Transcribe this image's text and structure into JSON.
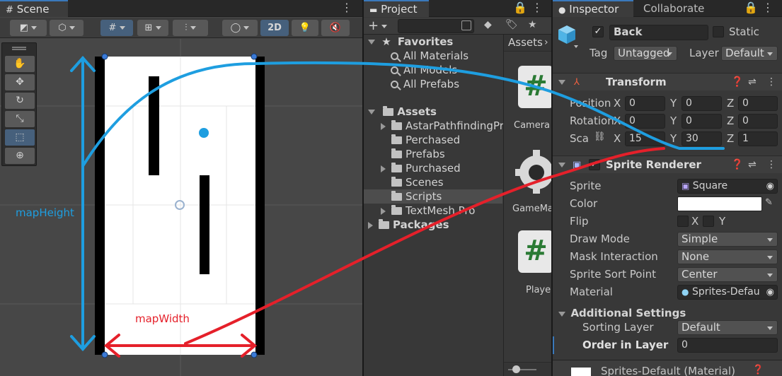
{
  "scene": {
    "tab_label": "Scene",
    "toolbar": {
      "mode_2d": "2D"
    },
    "annotations": {
      "map_height": "mapHeight",
      "map_width": "mapWidth"
    }
  },
  "project": {
    "tab_label": "Project",
    "breadcrumb": "Assets",
    "favorites": {
      "label": "Favorites",
      "items": [
        "All Materials",
        "All Models",
        "All Prefabs"
      ]
    },
    "assets": {
      "label": "Assets",
      "items": [
        "AstarPathfindingPr",
        "Perchased",
        "Prefabs",
        "Purchased",
        "Scenes",
        "Scripts",
        "TextMesh Pro"
      ]
    },
    "packages_label": "Packages",
    "grid_items": [
      "Camera",
      "GameMa",
      "Playe"
    ]
  },
  "inspector": {
    "tabs": [
      "Inspector",
      "Collaborate"
    ],
    "object": {
      "name": "Back",
      "static_label": "Static",
      "tag_label": "Tag",
      "tag_value": "Untagged",
      "layer_label": "Layer",
      "layer_value": "Default"
    },
    "transform": {
      "title": "Transform",
      "position_label": "Position",
      "rotation_label": "Rotation",
      "scale_label": "Sca",
      "axis_x": "X",
      "axis_y": "Y",
      "axis_z": "Z",
      "position": [
        "0",
        "0",
        "0"
      ],
      "rotation": [
        "0",
        "0",
        "0"
      ],
      "scale": [
        "15",
        "30",
        "1"
      ]
    },
    "sprite_renderer": {
      "title": "Sprite Renderer",
      "sprite_label": "Sprite",
      "sprite_value": "Square",
      "color_label": "Color",
      "flip_label": "Flip",
      "flip_x": "X",
      "flip_y": "Y",
      "draw_mode_label": "Draw Mode",
      "draw_mode_value": "Simple",
      "mask_label": "Mask Interaction",
      "mask_value": "None",
      "sort_point_label": "Sprite Sort Point",
      "sort_point_value": "Center",
      "material_label": "Material",
      "material_value": "Sprites-Defau",
      "additional_title": "Additional Settings",
      "sorting_layer_label": "Sorting Layer",
      "sorting_layer_value": "Default",
      "order_label": "Order in Layer",
      "order_value": "0"
    },
    "material_footer": "Sprites-Default (Material)"
  },
  "colors": {
    "annotation_blue": "#1e9ee0",
    "annotation_red": "#e5202a",
    "selection_blue": "#46607c"
  }
}
